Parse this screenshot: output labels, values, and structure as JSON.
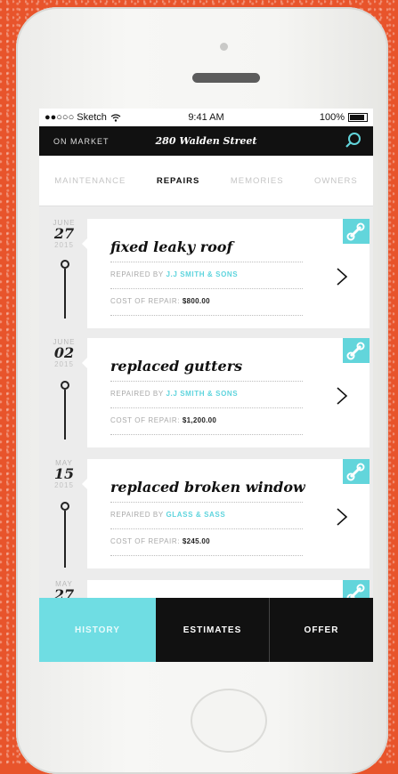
{
  "status": {
    "carrier": "●●○○○ Sketch",
    "time": "9:41 AM",
    "battery": "100%"
  },
  "nav": {
    "left": "ON MARKET",
    "title": "280 Walden Street",
    "search_icon": "search-icon"
  },
  "tabs": [
    {
      "label": "MAINTENANCE",
      "active": false
    },
    {
      "label": "REPAIRS",
      "active": true
    },
    {
      "label": "MEMORIES",
      "active": false
    },
    {
      "label": "OWNERS",
      "active": false
    }
  ],
  "entries": [
    {
      "month": "JUNE",
      "day": "27",
      "year": "2015",
      "title": "fixed leaky roof",
      "repaired_label": "REPAIRED BY",
      "company": "J.J SMITH & SONS",
      "cost_label": "COST OF REPAIR:",
      "cost": "$800.00"
    },
    {
      "month": "JUNE",
      "day": "02",
      "year": "2015",
      "title": "replaced gutters",
      "repaired_label": "REPAIRED BY",
      "company": "J.J SMITH & SONS",
      "cost_label": "COST OF REPAIR:",
      "cost": "$1,200.00"
    },
    {
      "month": "MAY",
      "day": "15",
      "year": "2015",
      "title": "replaced broken window",
      "repaired_label": "REPAIRED BY",
      "company": "GLASS & SASS",
      "cost_label": "COST OF REPAIR:",
      "cost": "$245.00"
    },
    {
      "month": "MAY",
      "day": "27"
    }
  ],
  "bottom": {
    "history": "HISTORY",
    "estimates": "ESTIMATES",
    "offer": "OFFER"
  },
  "colors": {
    "accent": "#62d5db",
    "background": "#e8542b"
  }
}
